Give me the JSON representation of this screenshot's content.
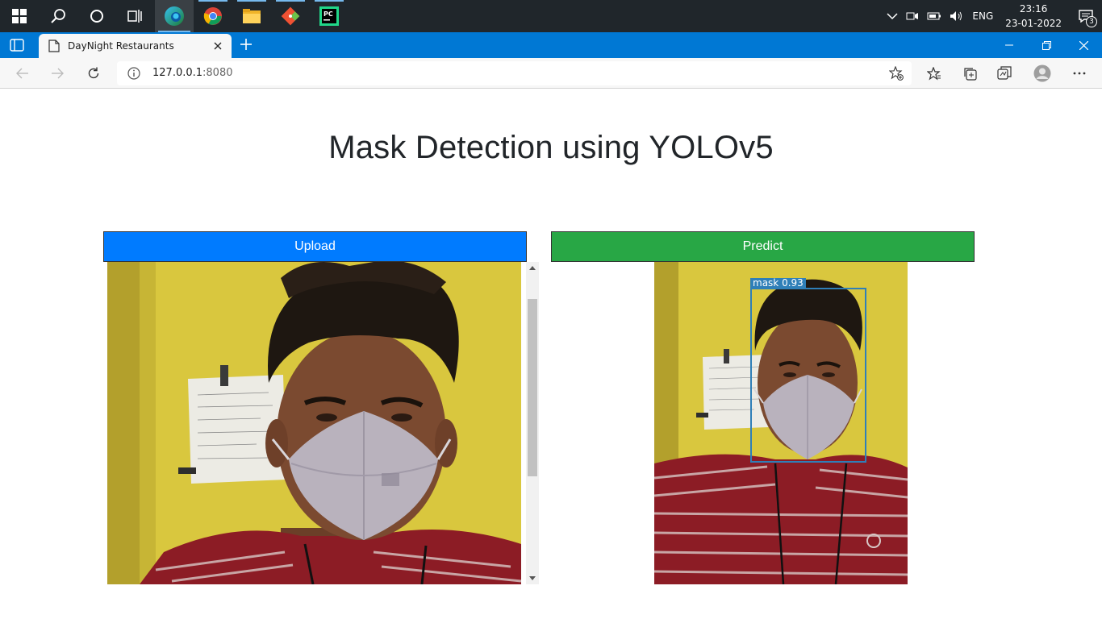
{
  "taskbar": {
    "apps": [
      "start",
      "search",
      "cortana",
      "task-view",
      "edge",
      "chrome",
      "file-explorer",
      "git",
      "pycharm"
    ],
    "tray": {
      "language": "ENG",
      "time": "23:16",
      "date": "23-01-2022",
      "notification_count": "3"
    }
  },
  "browser": {
    "tab_title": "DayNight Restaurants",
    "url_host": "127.0.0.1",
    "url_port": ":8080"
  },
  "page": {
    "title": "Mask Detection using YOLOv5",
    "upload_label": "Upload",
    "predict_label": "Predict",
    "detection": {
      "label": "mask",
      "confidence": "0.93"
    }
  },
  "colors": {
    "taskbar": "#20262b",
    "edge_accent": "#0078d4",
    "upload_button": "#007bff",
    "predict_button": "#28a745",
    "bbox": "#2f7fb8"
  }
}
